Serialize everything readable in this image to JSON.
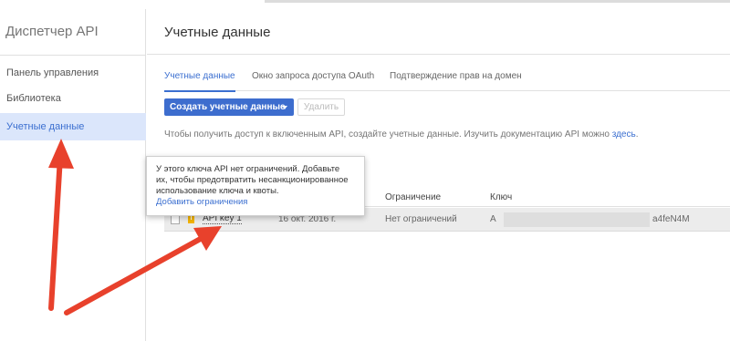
{
  "sidebar": {
    "title": "Диспетчер API",
    "items": [
      {
        "label": "Панель управления"
      },
      {
        "label": "Библиотека"
      },
      {
        "label": "Учетные данные"
      }
    ]
  },
  "main": {
    "title": "Учетные данные",
    "tabs": [
      {
        "label": "Учетные данные"
      },
      {
        "label": "Окно запроса доступа OAuth"
      },
      {
        "label": "Подтверждение прав на домен"
      }
    ],
    "create_button": "Создать учетные данные",
    "delete_button": "Удалить",
    "info_text": "Чтобы получить доступ к включенным API, создайте учетные данные. Изучить документацию API можно",
    "info_link": "здесь",
    "info_period": "."
  },
  "table": {
    "headers": {
      "restriction": "Ограничение",
      "key": "Ключ"
    },
    "rows": [
      {
        "name": "API key 1",
        "date": "16 окт. 2016 г.",
        "restriction": "Нет ограничений",
        "key_start": "A",
        "key_end": "a4feN4M"
      }
    ]
  },
  "tooltip": {
    "line1": "У этого ключа API нет ограничений. Добавьте",
    "line2": "их, чтобы предотвратить несанкционированное",
    "line3": "использование ключа и квоты.",
    "link": "Добавить ограничения"
  },
  "colors": {
    "accent": "#3b6fd0",
    "button": "#3d6dce",
    "arrow": "#e8412c",
    "active_bg": "#dbe6fb"
  }
}
